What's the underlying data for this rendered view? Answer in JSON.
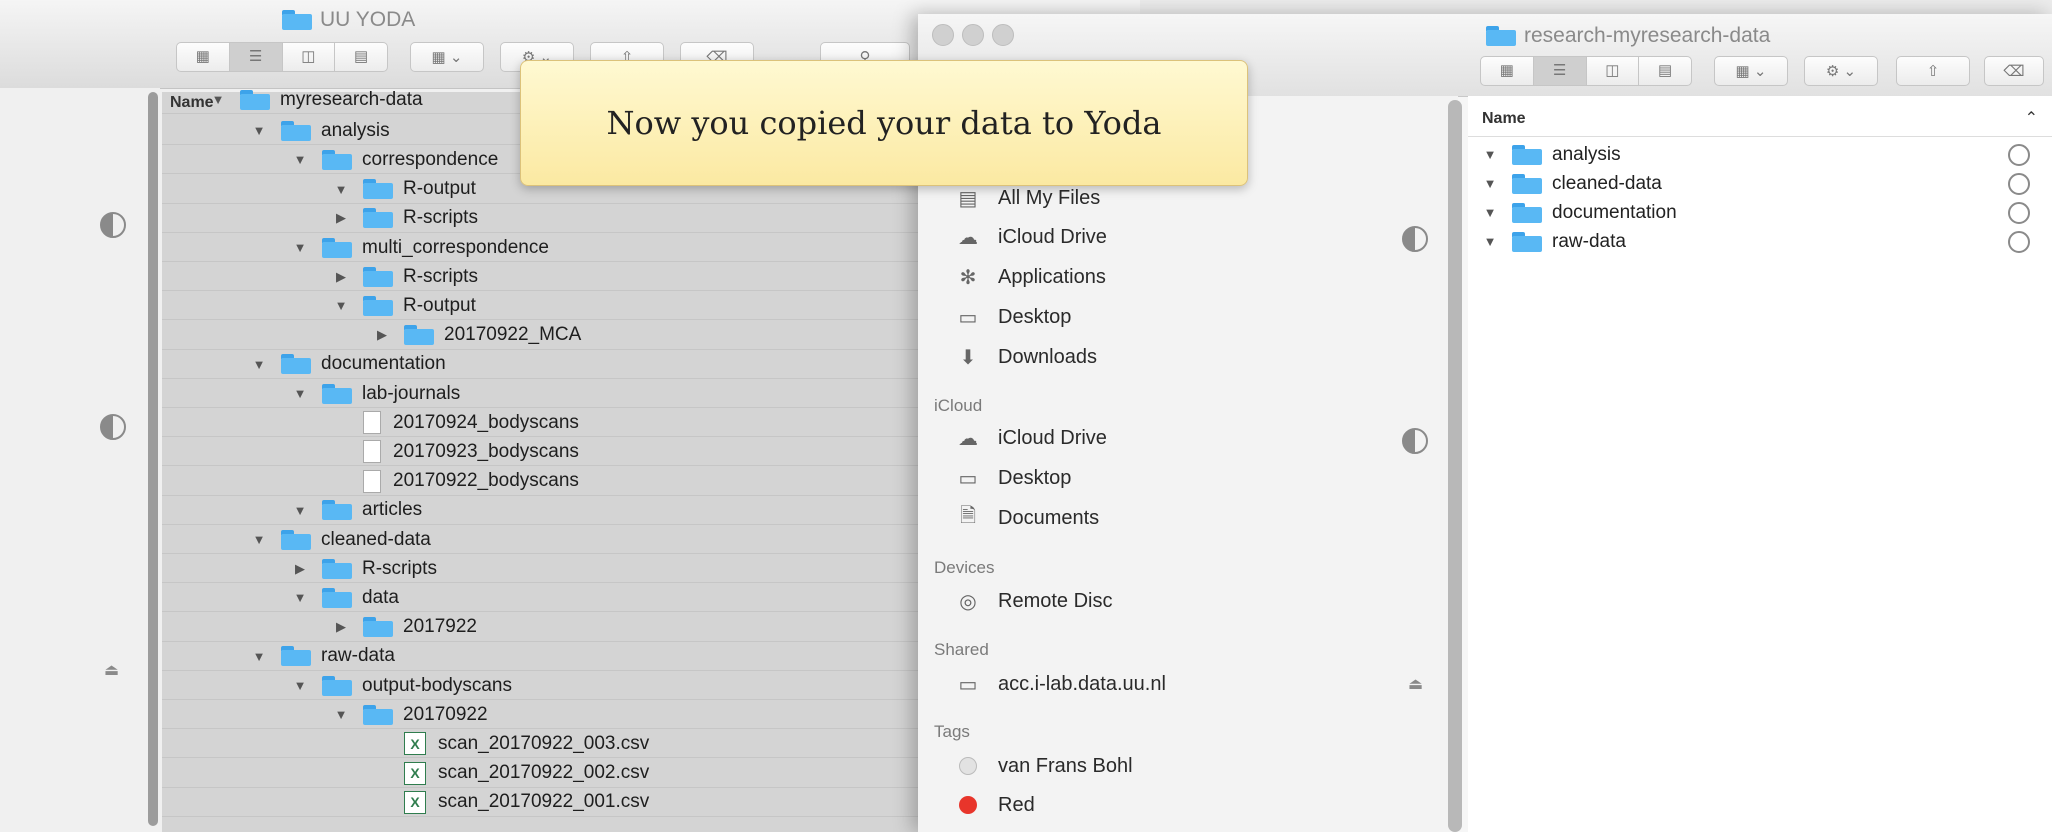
{
  "back_window": {
    "title": "UU YODA",
    "column_header": "Name",
    "rows": [
      {
        "label": "myresearch-data",
        "kind": "folder",
        "expanded": true,
        "level": 0
      },
      {
        "label": "analysis",
        "kind": "folder",
        "expanded": true,
        "level": 1
      },
      {
        "label": "correspondence",
        "kind": "folder",
        "expanded": true,
        "level": 2
      },
      {
        "label": "R-output",
        "kind": "folder",
        "expanded": true,
        "level": 3
      },
      {
        "label": "R-scripts",
        "kind": "folder",
        "expanded": false,
        "level": 3
      },
      {
        "label": "multi_correspondence",
        "kind": "folder",
        "expanded": true,
        "level": 2
      },
      {
        "label": "R-scripts",
        "kind": "folder",
        "expanded": false,
        "level": 3
      },
      {
        "label": "R-output",
        "kind": "folder",
        "expanded": true,
        "level": 3
      },
      {
        "label": "20170922_MCA",
        "kind": "folder",
        "expanded": false,
        "level": 4
      },
      {
        "label": "documentation",
        "kind": "folder",
        "expanded": true,
        "level": 1
      },
      {
        "label": "lab-journals",
        "kind": "folder",
        "expanded": true,
        "level": 2
      },
      {
        "label": "20170924_bodyscans",
        "kind": "file",
        "level": 3
      },
      {
        "label": "20170923_bodyscans",
        "kind": "file",
        "level": 3
      },
      {
        "label": "20170922_bodyscans",
        "kind": "file",
        "level": 3
      },
      {
        "label": "articles",
        "kind": "folder",
        "expanded": true,
        "level": 2
      },
      {
        "label": "cleaned-data",
        "kind": "folder",
        "expanded": true,
        "level": 1
      },
      {
        "label": "R-scripts",
        "kind": "folder",
        "expanded": false,
        "level": 2
      },
      {
        "label": "data",
        "kind": "folder",
        "expanded": true,
        "level": 2
      },
      {
        "label": "2017922",
        "kind": "folder",
        "expanded": false,
        "level": 3
      },
      {
        "label": "raw-data",
        "kind": "folder",
        "expanded": true,
        "level": 1
      },
      {
        "label": "output-bodyscans",
        "kind": "folder",
        "expanded": true,
        "level": 2
      },
      {
        "label": "20170922",
        "kind": "folder",
        "expanded": true,
        "level": 3
      },
      {
        "label": "scan_20170922_003.csv",
        "kind": "spreadsheet",
        "level": 4
      },
      {
        "label": "scan_20170922_002.csv",
        "kind": "spreadsheet",
        "level": 4
      },
      {
        "label": "scan_20170922_001.csv",
        "kind": "spreadsheet",
        "level": 4
      }
    ]
  },
  "front_window": {
    "title": "research-myresearch-data",
    "column_header": "Name",
    "sidebar": {
      "favorites": [
        {
          "label": "All My Files",
          "icon": "all-files-icon"
        },
        {
          "label": "iCloud Drive",
          "icon": "cloud-icon"
        },
        {
          "label": "Applications",
          "icon": "applications-icon"
        },
        {
          "label": "Desktop",
          "icon": "desktop-icon"
        },
        {
          "label": "Downloads",
          "icon": "download-icon"
        }
      ],
      "icloud_header": "iCloud",
      "icloud": [
        {
          "label": "iCloud Drive",
          "icon": "cloud-icon"
        },
        {
          "label": "Desktop",
          "icon": "desktop-icon"
        },
        {
          "label": "Documents",
          "icon": "documents-icon"
        }
      ],
      "devices_header": "Devices",
      "devices": [
        {
          "label": "Remote Disc",
          "icon": "disc-icon"
        }
      ],
      "shared_header": "Shared",
      "shared": [
        {
          "label": "acc.i-lab.data.uu.nl",
          "icon": "monitor-icon"
        }
      ],
      "tags_header": "Tags",
      "tags": [
        {
          "label": "van Frans Bohl",
          "color": "#d9d9d9"
        },
        {
          "label": "Red",
          "color": "#e8352b"
        }
      ]
    },
    "rows": [
      {
        "label": "analysis"
      },
      {
        "label": "cleaned-data"
      },
      {
        "label": "documentation"
      },
      {
        "label": "raw-data"
      }
    ]
  },
  "tooltip": {
    "text": "Now you copied your data to Yoda"
  }
}
